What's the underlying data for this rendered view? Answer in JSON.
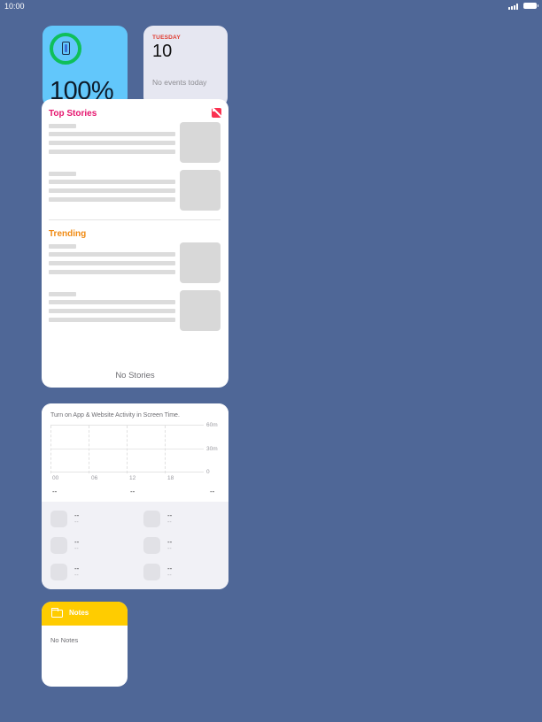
{
  "status_bar": {
    "time": "10:00",
    "icons": [
      "signal-icon",
      "battery-icon"
    ]
  },
  "battery_widget": {
    "percentage": "100%",
    "level": 1.0,
    "icon": "iphone-icon",
    "ring_color": "#0fbf5a"
  },
  "calendar_widget": {
    "weekday": "TUESDAY",
    "date": "10",
    "events_text": "No events today",
    "accent": "#e03a2f"
  },
  "news_widget": {
    "section_top": "Top Stories",
    "section_trending": "Trending",
    "footer": "No Stories",
    "icon": "news-icon",
    "top_color": "#e5156e",
    "trending_color": "#f08a12"
  },
  "screen_time_widget": {
    "message": "Turn on App & Website Activity in Screen Time.",
    "y_labels": [
      "60m",
      "30m",
      "0"
    ],
    "x_labels": [
      "00",
      "06",
      "12",
      "18"
    ],
    "summary": [
      "--",
      "--",
      "--"
    ],
    "apps": [
      {
        "value": "--",
        "detail": "--"
      },
      {
        "value": "--",
        "detail": "--"
      },
      {
        "value": "--",
        "detail": "--"
      },
      {
        "value": "--",
        "detail": "--"
      },
      {
        "value": "--",
        "detail": "--"
      },
      {
        "value": "--",
        "detail": "--"
      }
    ]
  },
  "notes_widget": {
    "title": "Notes",
    "empty_text": "No Notes",
    "icon": "folder-icon",
    "accent": "#ffcc00"
  }
}
